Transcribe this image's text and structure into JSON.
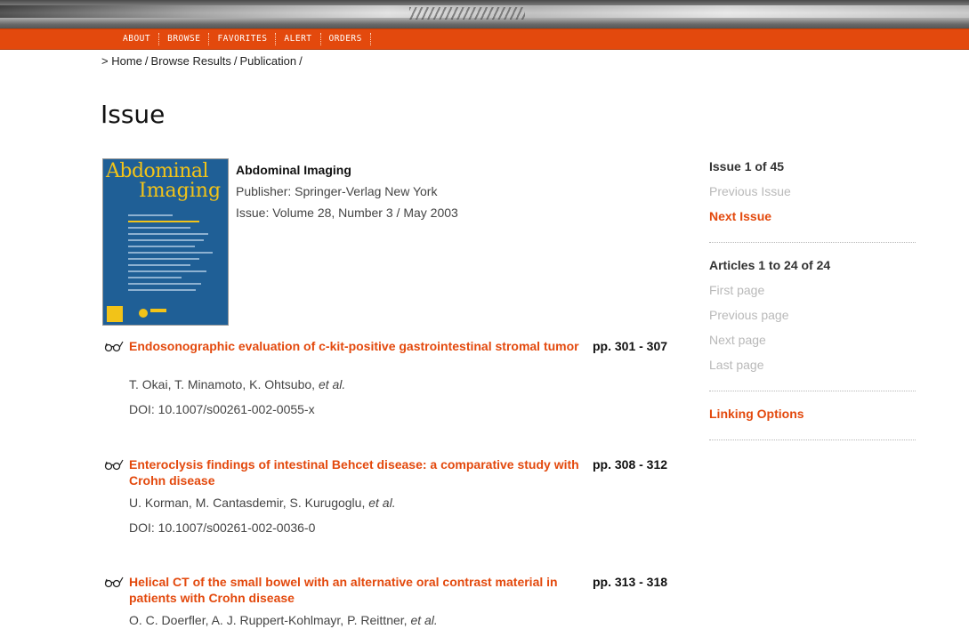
{
  "nav": {
    "items": [
      "ABOUT",
      "BROWSE",
      "FAVORITES",
      "ALERT",
      "ORDERS"
    ]
  },
  "breadcrumb": {
    "prefix": ">",
    "items": [
      "Home",
      "Browse Results",
      "Publication"
    ],
    "separator": "/"
  },
  "page": {
    "title": "Issue"
  },
  "cover": {
    "title_line1": "Abdominal",
    "title_line2": "Imaging"
  },
  "publication": {
    "title": "Abdominal Imaging",
    "publisher": "Publisher: Springer-Verlag New York",
    "issue": "Issue: Volume 28, Number 3 / May 2003"
  },
  "articles": [
    {
      "title": "Endosonographic evaluation of c-kit-positive gastrointestinal stromal tumor",
      "pages": "pp. 301 - 307",
      "authors": "T. Okai, T. Minamoto, K. Ohtsubo, ",
      "et_al": "et al.",
      "doi": "DOI: 10.1007/s00261-002-0055-x"
    },
    {
      "title": "Enteroclysis findings of intestinal Behcet disease: a comparative study with Crohn disease",
      "pages": "pp. 308 - 312",
      "authors": "U. Korman, M. Cantasdemir, S. Kurugoglu, ",
      "et_al": "et al.",
      "doi": "DOI: 10.1007/s00261-002-0036-0"
    },
    {
      "title": "Helical CT of the small bowel with an alternative oral contrast material in patients with Crohn disease",
      "pages": "pp. 313 - 318",
      "authors": "O. C. Doerfler, A. J. Ruppert-Kohlmayr, P. Reittner, ",
      "et_al": "et al."
    }
  ],
  "sidebar": {
    "issue_nav": {
      "heading": "Issue 1 of 45",
      "previous": "Previous Issue",
      "next": "Next Issue"
    },
    "article_nav": {
      "heading": "Articles 1 to 24 of 24",
      "first": "First page",
      "previous": "Previous page",
      "next": "Next page",
      "last": "Last page"
    },
    "linking_options": "Linking Options"
  },
  "colors": {
    "accent": "#e3490d",
    "disabled": "#b9b9b9",
    "cover_blue": "#1f5f96",
    "cover_yellow": "#f2c318"
  }
}
